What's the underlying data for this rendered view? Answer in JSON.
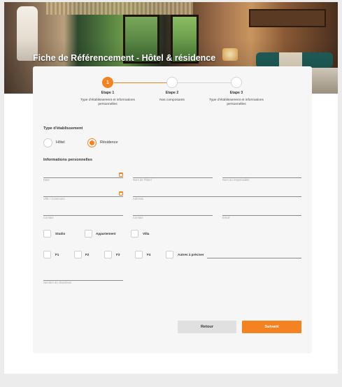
{
  "header": {
    "title": "Fiche de Référencement - Hôtel & résidence"
  },
  "stepper": [
    {
      "number": "1",
      "title": "Etape 1",
      "description": "Type d'établissement et informations personnelles"
    },
    {
      "number": "",
      "title": "Etape 2",
      "description": "Nos composants"
    },
    {
      "number": "",
      "title": "Etape 3",
      "description": "Type d'établissement et informations personnelles"
    }
  ],
  "establishment": {
    "section_title": "Type d'établissement",
    "options": [
      "Hôtel",
      "Résidence"
    ],
    "selected": "Résidence"
  },
  "personal": {
    "section_title": "Informations personnelles",
    "fields": {
      "date": "Date",
      "hotel_name": "Nom de l'hôtel",
      "manager_name": "Nom du responsable",
      "city": "Ville / Commune",
      "address": "Adresse",
      "contact1": "Contact",
      "contact2": "Contact",
      "email": "Email",
      "rooms": "Nombre de chambres"
    }
  },
  "unit_types": [
    "Studio",
    "Appartement",
    "Villa"
  ],
  "room_types": [
    "F1",
    "F2",
    "F3",
    "F4",
    "Autres à préciser"
  ],
  "buttons": {
    "back": "Retour",
    "next": "Suivant"
  },
  "colors": {
    "accent": "#f58220",
    "card": "#f6f6f6"
  }
}
